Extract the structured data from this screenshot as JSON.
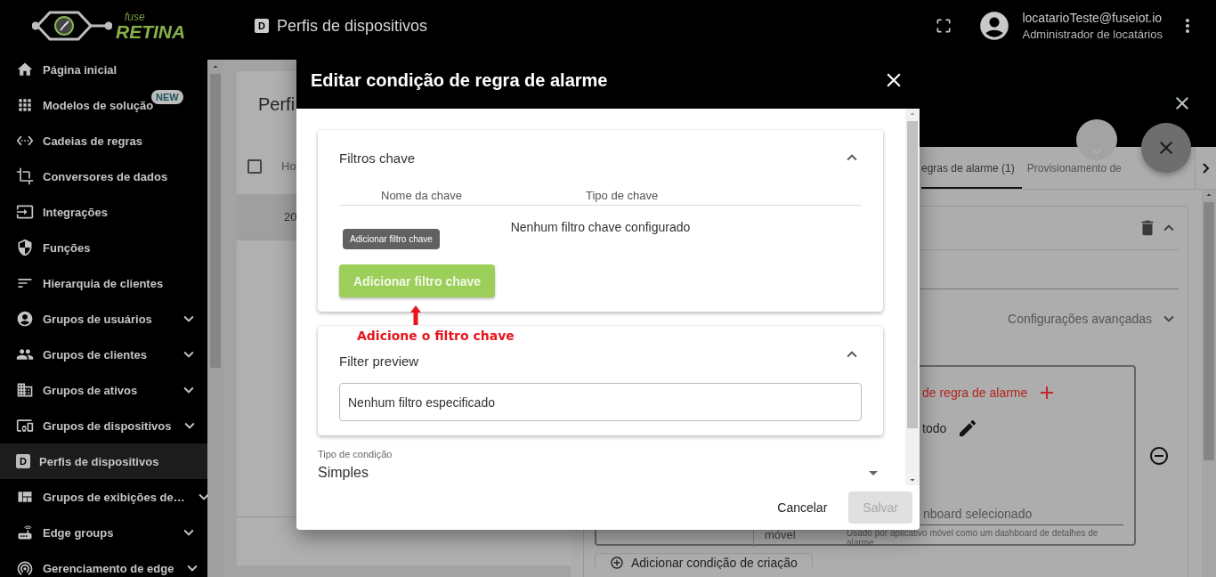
{
  "app_bar": {
    "logo": {
      "prefix": "fuse",
      "name": "RETINA"
    },
    "page_icon_letter": "D",
    "page_title": "Perfis de dispositivos",
    "user": {
      "email": "locatarioTeste@fuseiot.io",
      "role": "Administrador de locatários"
    }
  },
  "sidebar": {
    "items": [
      {
        "label": "Página inicial",
        "selected": false,
        "expandable": false
      },
      {
        "label": "Modelos de solução",
        "selected": false,
        "expandable": false,
        "badge": "NEW"
      },
      {
        "label": "Cadeias de regras",
        "selected": false,
        "expandable": false
      },
      {
        "label": "Conversores de dados",
        "selected": false,
        "expandable": false
      },
      {
        "label": "Integrações",
        "selected": false,
        "expandable": false
      },
      {
        "label": "Funções",
        "selected": false,
        "expandable": false
      },
      {
        "label": "Hierarquia de clientes",
        "selected": false,
        "expandable": false
      },
      {
        "label": "Grupos de usuários",
        "selected": false,
        "expandable": true
      },
      {
        "label": "Grupos de clientes",
        "selected": false,
        "expandable": true
      },
      {
        "label": "Grupos de ativos",
        "selected": false,
        "expandable": true
      },
      {
        "label": "Grupos de dispositivos",
        "selected": false,
        "expandable": true
      },
      {
        "label": "Perfis de dispositivos",
        "selected": true,
        "expandable": false,
        "icon_letter": "D"
      },
      {
        "label": "Grupos de exibições de…",
        "selected": false,
        "expandable": true
      },
      {
        "label": "Edge groups",
        "selected": false,
        "expandable": true
      },
      {
        "label": "Gerenciamento de edge",
        "selected": false,
        "expandable": true
      }
    ]
  },
  "page": {
    "title": "Perfi",
    "table": {
      "select_all_checked": false,
      "columns": [
        "Ho"
      ],
      "rows": [
        {
          "cells": [
            "20"
          ],
          "selected": true
        }
      ]
    }
  },
  "drawer": {
    "tabs": [
      {
        "label": "egras de alarme (1)",
        "selected": true
      },
      {
        "label": "Provisionamento de",
        "selected": false
      }
    ],
    "advanced": {
      "label": "Configurações avançadas",
      "expanded": false
    },
    "rule": {
      "heading": "de regra de alarme",
      "schedule": "todo",
      "column_2_text": "móvel",
      "dashboard_field": {
        "placeholder": "nboard selecionado",
        "hint": "Usado por aplicativo móvel como um dashboard de detalhes de alarme"
      }
    },
    "add_condition": "Adicionar condição de criação"
  },
  "dialog": {
    "title": "Editar condição de regra de alarme",
    "key_filters": {
      "title": "Filtros chave",
      "expanded": true,
      "columns": [
        "Nome da chave",
        "Tipo de chave"
      ],
      "empty": "Nenhum filtro chave configurado",
      "tooltip": "Adicionar filtro chave",
      "add_button": "Adicionar filtro chave",
      "annotation": "Adicione o filtro chave"
    },
    "filter_preview": {
      "title": "Filter preview",
      "expanded": true,
      "value": "Nenhum filtro especificado"
    },
    "condition_type": {
      "label": "Tipo de condição",
      "value": "Simples"
    },
    "buttons": [
      {
        "label": "Cancelar",
        "disabled": false
      },
      {
        "label": "Salvar",
        "disabled": true
      }
    ]
  }
}
